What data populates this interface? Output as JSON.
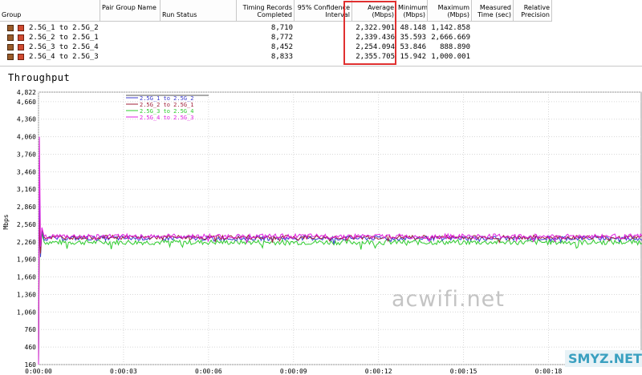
{
  "table": {
    "columns": [
      "Group",
      "Pair Group Name",
      "Run Status",
      "Timing Records Completed",
      "95% Confidence Interval",
      "Average (Mbps)",
      "Minimum (Mbps)",
      "Maximum (Mbps)",
      "Measured Time (sec)",
      "Relative Precision"
    ],
    "rows": [
      {
        "group": "2.5G_1 to 2.5G_2",
        "records": "8,710",
        "average": "2,322.901",
        "minimum": "48.148",
        "maximum": "1,142.858"
      },
      {
        "group": "2.5G_2 to 2.5G_1",
        "records": "8,772",
        "average": "2,339.436",
        "minimum": "35.593",
        "maximum": "2,666.669"
      },
      {
        "group": "2.5G_3 to 2.5G_4",
        "records": "8,452",
        "average": "2,254.094",
        "minimum": "53.846",
        "maximum": "888.890"
      },
      {
        "group": "2.5G_4 to 2.5G_3",
        "records": "8,833",
        "average": "2,355.705",
        "minimum": "15.942",
        "maximum": "1,000.001"
      }
    ]
  },
  "chart_title": "Throughput",
  "colors": {
    "series1": "#3b3bd0",
    "series2": "#a0203a",
    "series3": "#2ecc2e",
    "series4": "#e020e0",
    "highlight": "#e03030"
  },
  "chart_data": {
    "type": "line",
    "title": "Throughput",
    "ylabel": "Mbps",
    "xlabel": "",
    "ylim": [
      160,
      4822
    ],
    "yticks": [
      "4,822",
      "4,660",
      "4,360",
      "4,060",
      "3,760",
      "3,460",
      "3,160",
      "2,860",
      "2,560",
      "2,260",
      "1,960",
      "1,660",
      "1,360",
      "1,060",
      "760",
      "460",
      "160"
    ],
    "xticks": [
      "0:00:00",
      "0:00:03",
      "0:00:06",
      "0:00:09",
      "0:00:12",
      "0:00:15",
      "0:00:18"
    ],
    "x_range_sec": [
      0,
      21.3
    ],
    "legend_position": "top-left",
    "series": [
      {
        "name": "2.5G_1 to 2.5G_2",
        "mean": 2323,
        "noise": 40
      },
      {
        "name": "2.5G_2 to 2.5G_1",
        "mean": 2339,
        "noise": 35
      },
      {
        "name": "2.5G_3 to 2.5G_4",
        "mean": 2254,
        "noise": 45
      },
      {
        "name": "2.5G_4 to 2.5G_3",
        "mean": 2356,
        "noise": 40
      }
    ]
  },
  "watermarks": [
    "acwifi.net",
    "SMYZ.NET"
  ]
}
